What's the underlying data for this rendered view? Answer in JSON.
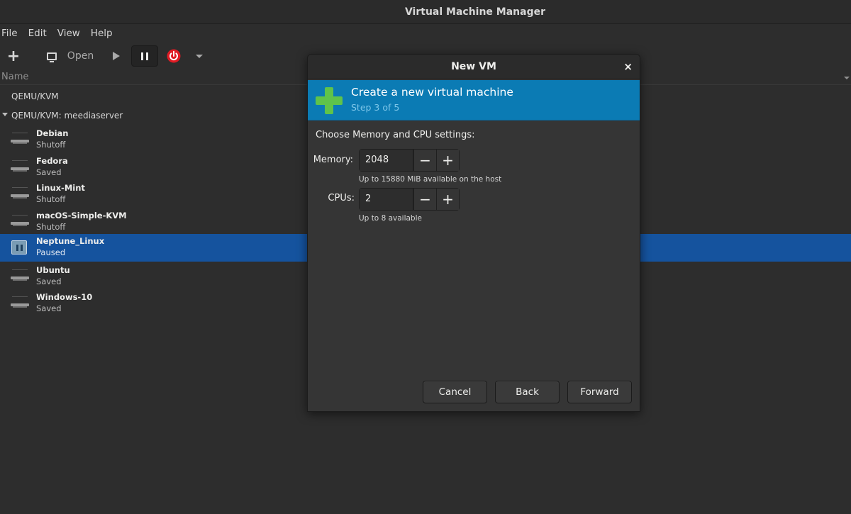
{
  "window": {
    "title": "Virtual Machine Manager"
  },
  "menubar": {
    "items": [
      "File",
      "Edit",
      "View",
      "Help"
    ]
  },
  "toolbar": {
    "open_label": "Open"
  },
  "list": {
    "header": "Name",
    "connections": [
      {
        "label": "QEMU/KVM"
      },
      {
        "label": "QEMU/KVM: meediaserver"
      }
    ],
    "vms": [
      {
        "name": "Debian",
        "status": "Shutoff"
      },
      {
        "name": "Fedora",
        "status": "Saved"
      },
      {
        "name": "Linux-Mint",
        "status": "Shutoff"
      },
      {
        "name": "macOS-Simple-KVM",
        "status": "Shutoff"
      },
      {
        "name": "Neptune_Linux",
        "status": "Paused"
      },
      {
        "name": "Ubuntu",
        "status": "Saved"
      },
      {
        "name": "Windows-10",
        "status": "Saved"
      }
    ],
    "selected_vm": "Neptune_Linux"
  },
  "dialog": {
    "title": "New VM",
    "close_glyph": "×",
    "banner_title": "Create a new virtual machine",
    "banner_step": "Step 3 of 5",
    "section": "Choose Memory and CPU settings:",
    "memory": {
      "label": "Memory:",
      "value": "2048",
      "hint": "Up to 15880 MiB available on the host"
    },
    "cpus": {
      "label": "CPUs:",
      "value": "2",
      "hint": "Up to 8 available"
    },
    "buttons": {
      "cancel": "Cancel",
      "back": "Back",
      "forward": "Forward"
    }
  },
  "colors": {
    "selection": "#15539e",
    "banner": "#0b7bb4",
    "accent_green": "#5fc34a",
    "power_red": "#e01b24"
  }
}
